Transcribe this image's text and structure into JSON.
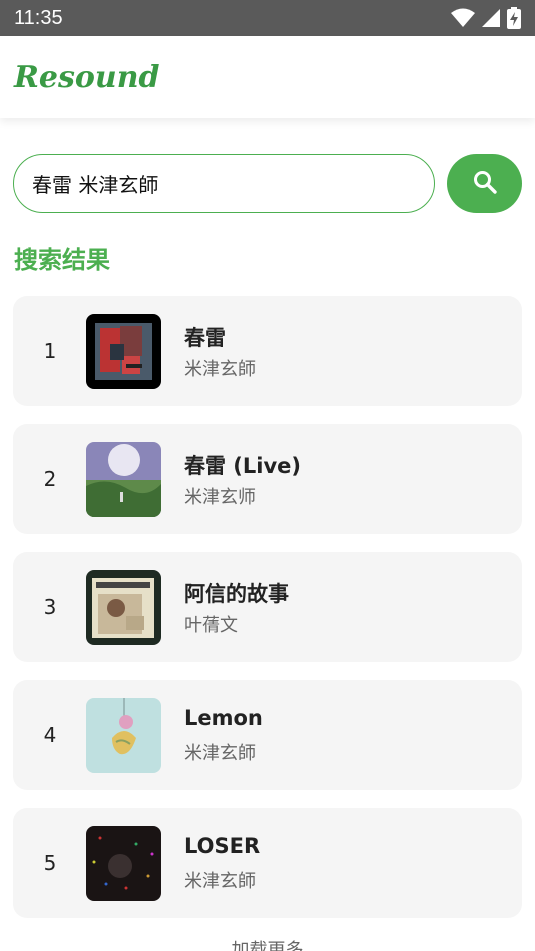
{
  "status_bar": {
    "time": "11:35",
    "icons": [
      "wifi-icon",
      "signal-icon",
      "battery-charging-icon"
    ]
  },
  "app": {
    "logo": "Resound",
    "accent_color": "#4caf50"
  },
  "search": {
    "query": "春雷 米津玄師",
    "button_icon": "search-icon"
  },
  "results": {
    "heading": "搜索结果",
    "items": [
      {
        "index": "1",
        "title": "春雷",
        "artist": "米津玄師"
      },
      {
        "index": "2",
        "title": "春雷 (Live)",
        "artist": "米津玄师"
      },
      {
        "index": "3",
        "title": "阿信的故事",
        "artist": "叶蒨文"
      },
      {
        "index": "4",
        "title": "Lemon",
        "artist": "米津玄師"
      },
      {
        "index": "5",
        "title": "LOSER",
        "artist": "米津玄師"
      }
    ],
    "load_more": "加载更多"
  }
}
